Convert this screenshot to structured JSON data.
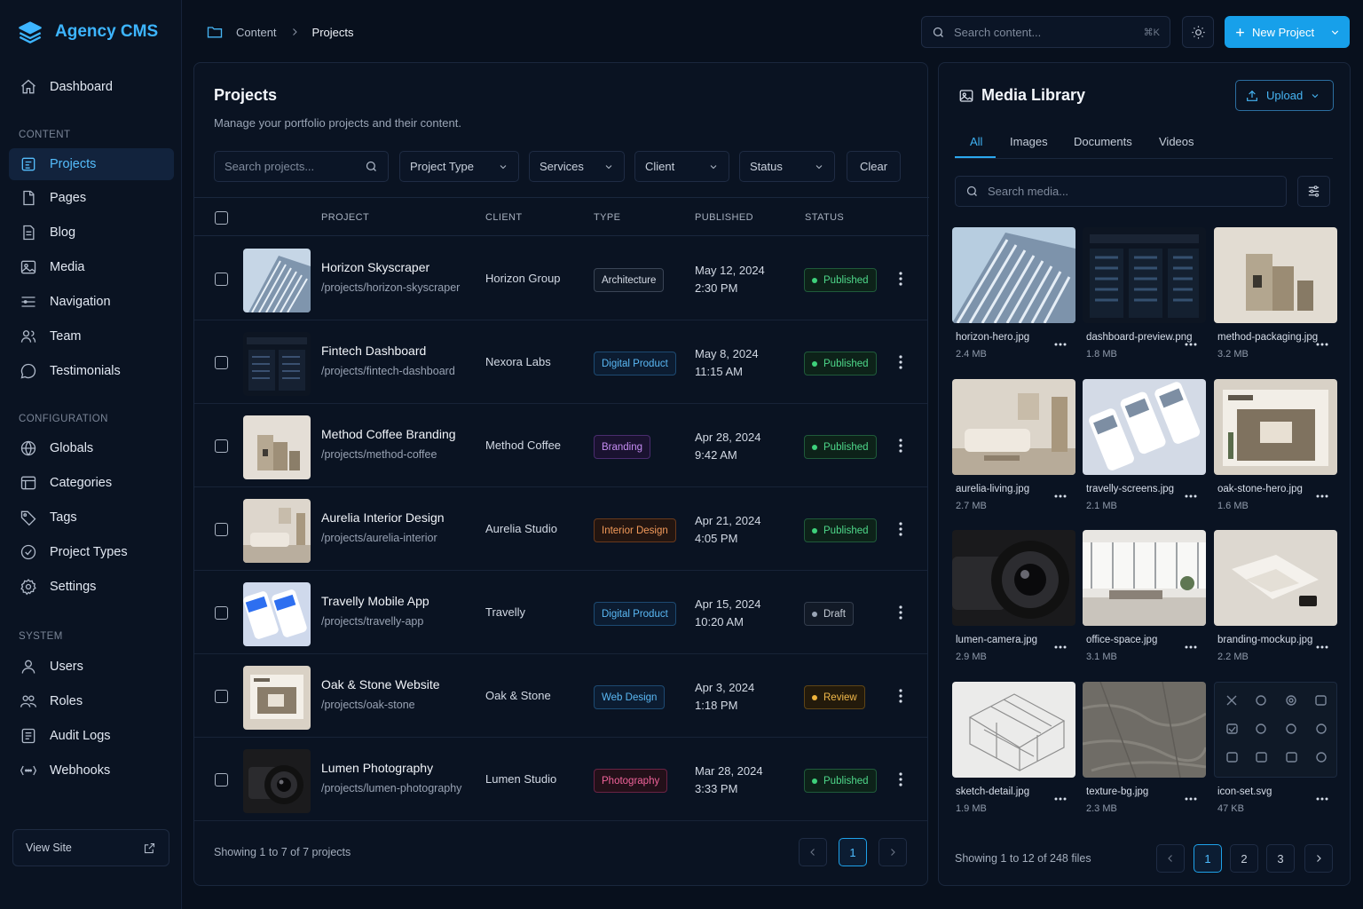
{
  "sidebar": {
    "brand": "Agency CMS",
    "dashboard": "Dashboard",
    "sections": {
      "content": "CONTENT",
      "configuration": "CONFIGURATION",
      "system": "SYSTEM"
    },
    "content_items": [
      "Projects",
      "Pages",
      "Blog",
      "Media",
      "Navigation",
      "Team",
      "Testimonials"
    ],
    "config_items": [
      "Globals",
      "Categories",
      "Tags",
      "Project Types",
      "Settings"
    ],
    "system_items": [
      "Users",
      "Roles",
      "Audit Logs",
      "Webhooks"
    ],
    "view_site": "View Site"
  },
  "topbar": {
    "breadcrumb": [
      "Content",
      "Projects"
    ],
    "search_placeholder": "Search content...",
    "shortcut": "⌘K",
    "new_project": "New Project"
  },
  "projects": {
    "title": "Projects",
    "subtitle": "Manage your portfolio projects and their content.",
    "search_placeholder": "Search projects...",
    "filters": [
      "Project Type",
      "Services",
      "Client",
      "Status"
    ],
    "clear": "Clear",
    "columns": [
      "PROJECT",
      "CLIENT",
      "TYPE",
      "PUBLISHED",
      "STATUS"
    ],
    "rows": [
      {
        "name": "Horizon Skyscraper",
        "slug": "/projects/horizon-skyscraper",
        "client": "Horizon Group",
        "type": "Architecture",
        "date": "May 12, 2024",
        "time": "2:30 PM",
        "status": "Published"
      },
      {
        "name": "Fintech Dashboard",
        "slug": "/projects/fintech-dashboard",
        "client": "Nexora Labs",
        "type": "Digital Product",
        "date": "May 8, 2024",
        "time": "11:15 AM",
        "status": "Published"
      },
      {
        "name": "Method Coffee Branding",
        "slug": "/projects/method-coffee",
        "client": "Method Coffee",
        "type": "Branding",
        "date": "Apr 28, 2024",
        "time": "9:42 AM",
        "status": "Published"
      },
      {
        "name": "Aurelia Interior Design",
        "slug": "/projects/aurelia-interior",
        "client": "Aurelia Studio",
        "type": "Interior Design",
        "date": "Apr 21, 2024",
        "time": "4:05 PM",
        "status": "Published"
      },
      {
        "name": "Travelly Mobile App",
        "slug": "/projects/travelly-app",
        "client": "Travelly",
        "type": "Digital Product",
        "date": "Apr 15, 2024",
        "time": "10:20 AM",
        "status": "Draft"
      },
      {
        "name": "Oak & Stone Website",
        "slug": "/projects/oak-stone",
        "client": "Oak & Stone",
        "type": "Web Design",
        "date": "Apr 3, 2024",
        "time": "1:18 PM",
        "status": "Review"
      },
      {
        "name": "Lumen Photography",
        "slug": "/projects/lumen-photography",
        "client": "Lumen Studio",
        "type": "Photography",
        "date": "Mar 28, 2024",
        "time": "3:33 PM",
        "status": "Published"
      }
    ],
    "footer": "Showing 1 to 7 of 7 projects",
    "page": "1"
  },
  "media": {
    "title": "Media Library",
    "upload": "Upload",
    "tabs": [
      "All",
      "Images",
      "Documents",
      "Videos"
    ],
    "search_placeholder": "Search media...",
    "files": [
      {
        "name": "horizon-hero.jpg",
        "size": "2.4 MB"
      },
      {
        "name": "dashboard-preview.png",
        "size": "1.8 MB"
      },
      {
        "name": "method-packaging.jpg",
        "size": "3.2 MB"
      },
      {
        "name": "aurelia-living.jpg",
        "size": "2.7 MB"
      },
      {
        "name": "travelly-screens.jpg",
        "size": "2.1 MB"
      },
      {
        "name": "oak-stone-hero.jpg",
        "size": "1.6 MB"
      },
      {
        "name": "lumen-camera.jpg",
        "size": "2.9 MB"
      },
      {
        "name": "office-space.jpg",
        "size": "3.1 MB"
      },
      {
        "name": "branding-mockup.jpg",
        "size": "2.2 MB"
      },
      {
        "name": "sketch-detail.jpg",
        "size": "1.9 MB"
      },
      {
        "name": "texture-bg.jpg",
        "size": "2.3 MB"
      },
      {
        "name": "icon-set.svg",
        "size": "47 KB"
      }
    ],
    "footer": "Showing 1 to 12 of 248 files",
    "pages": [
      "1",
      "2",
      "3"
    ]
  },
  "colors": {
    "accent": "#17a0ea",
    "background": "#08101d",
    "published": "#3ed17b",
    "review": "#f0b43c",
    "draft": "#9aa5b6"
  }
}
